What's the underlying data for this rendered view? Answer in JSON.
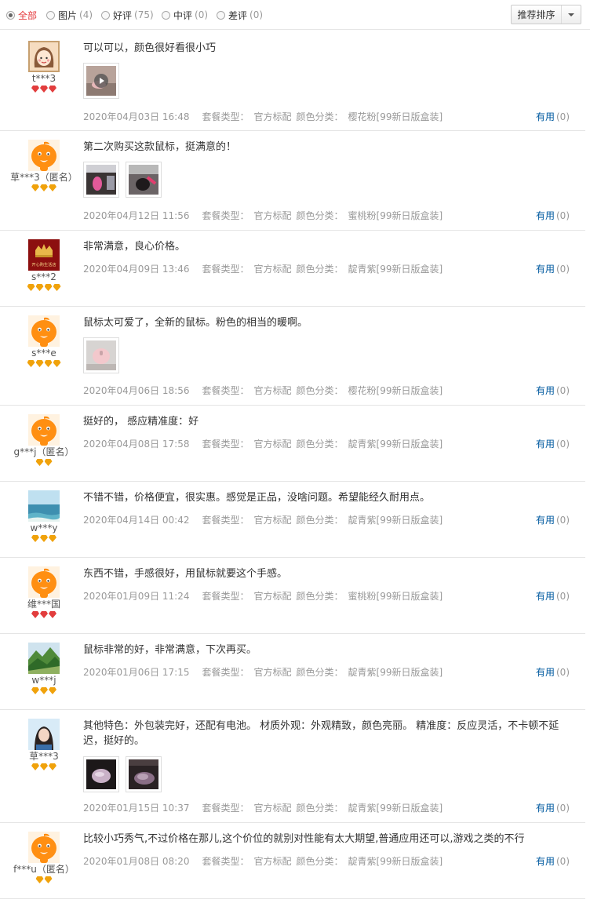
{
  "filters": [
    {
      "label": "全部",
      "count": "",
      "checked": true
    },
    {
      "label": "图片",
      "count": "(4)",
      "checked": false
    },
    {
      "label": "好评",
      "count": "(75)",
      "checked": false
    },
    {
      "label": "中评",
      "count": "(0)",
      "checked": false
    },
    {
      "label": "差评",
      "count": "(0)",
      "checked": false
    }
  ],
  "sort": {
    "label": "推荐排序"
  },
  "useful_label": "有用",
  "package_label": "套餐类型：",
  "color_label": "颜色分类：",
  "reviews": [
    {
      "user": "t***3",
      "avatar": "cartoon-girl",
      "rank": "red",
      "rank_count": 3,
      "text": "可以可以，颜色很好看很小巧",
      "pics": [
        "video-thumb"
      ],
      "date": "2020年04月03日 16:48",
      "package": "官方标配",
      "color": "樱花粉[99新日版盒装]",
      "useful_count": "(0)"
    },
    {
      "user": "草***3（匿名）",
      "avatar": "default-orange",
      "rank": "gold",
      "rank_count": 3,
      "text": "第二次购买这款鼠标，挺满意的！",
      "pics": [
        "pink-mouse-desk",
        "mouse-dark"
      ],
      "date": "2020年04月12日 11:56",
      "package": "官方标配",
      "color": "蜜桃粉[99新日版盒装]",
      "useful_count": "(0)"
    },
    {
      "user": "s***2",
      "avatar": "shop-logo",
      "avatar_text": "开心购生活店",
      "rank": "gold",
      "rank_count": 4,
      "text": "非常满意，良心价格。",
      "pics": [],
      "date": "2020年04月09日 13:46",
      "package": "官方标配",
      "color": "靛青紫[99新日版盒装]",
      "useful_count": "(0)"
    },
    {
      "user": "s***e",
      "avatar": "default-orange",
      "rank": "gold",
      "rank_count": 4,
      "text": "鼠标太可爱了，全新的鼠标。粉色的相当的暖啊。",
      "pics": [
        "pink-mouse-light"
      ],
      "date": "2020年04月06日 18:56",
      "package": "官方标配",
      "color": "樱花粉[99新日版盒装]",
      "useful_count": "(0)"
    },
    {
      "user": "g***j（匿名）",
      "avatar": "default-orange",
      "rank": "gold",
      "rank_count": 2,
      "text": "挺好的， 感应精准度：好",
      "pics": [],
      "date": "2020年04月08日 17:58",
      "package": "官方标配",
      "color": "靛青紫[99新日版盒装]",
      "useful_count": "(0)"
    },
    {
      "user": "w***y",
      "avatar": "sea-landscape",
      "rank": "gold",
      "rank_count": 3,
      "text": "不错不错，价格便宜，很实惠。感觉是正品，没啥问题。希望能经久耐用点。",
      "pics": [],
      "date": "2020年04月14日 00:42",
      "package": "官方标配",
      "color": "靛青紫[99新日版盒装]",
      "useful_count": "(0)"
    },
    {
      "user": "维***国",
      "avatar": "default-orange",
      "rank": "red",
      "rank_count": 3,
      "text": "东西不错，手感很好，用鼠标就要这个手感。",
      "pics": [],
      "date": "2020年01月09日 11:24",
      "package": "官方标配",
      "color": "蜜桃粉[99新日版盒装]",
      "useful_count": "(0)"
    },
    {
      "user": "w***j",
      "avatar": "mountain-landscape",
      "rank": "gold",
      "rank_count": 3,
      "text": "鼠标非常的好，非常满意，下次再买。",
      "pics": [],
      "date": "2020年01月06日 17:15",
      "package": "官方标配",
      "color": "靛青紫[99新日版盒装]",
      "useful_count": "(0)"
    },
    {
      "user": "草***3",
      "avatar": "girl-photo",
      "rank": "gold",
      "rank_count": 3,
      "text": "其他特色：外包装完好，还配有电池。 材质外观：外观精致，颜色亮丽。 精准度：反应灵活，不卡顿不延迟，挺好的。",
      "pics": [
        "purple-mouse-dark",
        "purple-mouse-hand"
      ],
      "date": "2020年01月15日 10:37",
      "package": "官方标配",
      "color": "靛青紫[99新日版盒装]",
      "useful_count": "(0)"
    },
    {
      "user": "f***u（匿名）",
      "avatar": "default-orange",
      "rank": "gold",
      "rank_count": 2,
      "text": "比较小巧秀气,不过价格在那儿,这个价位的就别对性能有太大期望,普通应用还可以,游戏之类的不行",
      "pics": [],
      "date": "2020年01月08日 08:20",
      "package": "官方标配",
      "color": "靛青紫[99新日版盒装]",
      "useful_count": "(0)"
    }
  ]
}
